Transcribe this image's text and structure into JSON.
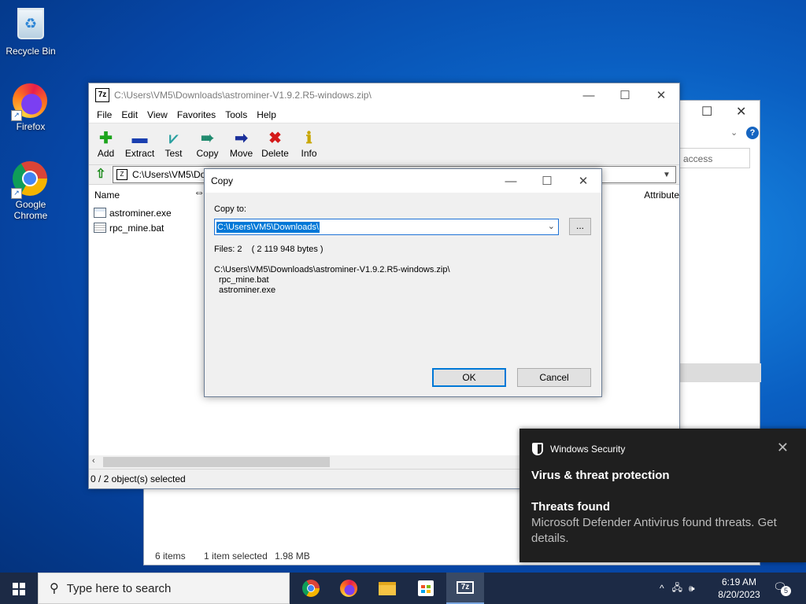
{
  "desktop": {
    "icons": [
      {
        "label": "Recycle Bin"
      },
      {
        "label": "Firefox"
      },
      {
        "label": "Google Chrome"
      }
    ]
  },
  "explorer": {
    "search_placeholder": "access",
    "help_glyph": "?",
    "status": {
      "items": "6 items",
      "selected": "1 item selected",
      "size": "1.98 MB"
    }
  },
  "sevenzip": {
    "title": "C:\\Users\\VM5\\Downloads\\astrominer-V1.9.2.R5-windows.zip\\",
    "app_icon": "7z",
    "menu": [
      "File",
      "Edit",
      "View",
      "Favorites",
      "Tools",
      "Help"
    ],
    "toolbar": [
      {
        "label": "Add",
        "icon": "plus-icon"
      },
      {
        "label": "Extract",
        "icon": "minus-icon"
      },
      {
        "label": "Test",
        "icon": "check-icon"
      },
      {
        "label": "Copy",
        "icon": "arrow-right-double-icon"
      },
      {
        "label": "Move",
        "icon": "arrow-right-icon"
      },
      {
        "label": "Delete",
        "icon": "x-icon"
      },
      {
        "label": "Info",
        "icon": "info-icon"
      }
    ],
    "address": "C:\\Users\\VM5\\Do",
    "columns": {
      "name": "Name",
      "attributes": "Attribute"
    },
    "files": [
      {
        "name": "astrominer.exe",
        "type": "exe"
      },
      {
        "name": "rpc_mine.bat",
        "type": "bat"
      }
    ],
    "status": "0 / 2 object(s) selected"
  },
  "dialog": {
    "title": "Copy",
    "copy_to_label": "Copy to:",
    "copy_to_value": "C:\\Users\\VM5\\Downloads\\",
    "browse_label": "...",
    "files_summary": "Files: 2    ( 2 119 948 bytes )",
    "source_path": "C:\\Users\\VM5\\Downloads\\astrominer-V1.9.2.R5-windows.zip\\",
    "source_files": [
      "rpc_mine.bat",
      "astrominer.exe"
    ],
    "ok_label": "OK",
    "cancel_label": "Cancel"
  },
  "toast": {
    "app": "Windows Security",
    "heading": "Virus & threat protection",
    "subheading": "Threats found",
    "body": "Microsoft Defender Antivirus found threats. Get details."
  },
  "taskbar": {
    "search_placeholder": "Type here to search",
    "time": "6:19 AM",
    "date": "8/20/2023",
    "notification_count": "5"
  }
}
